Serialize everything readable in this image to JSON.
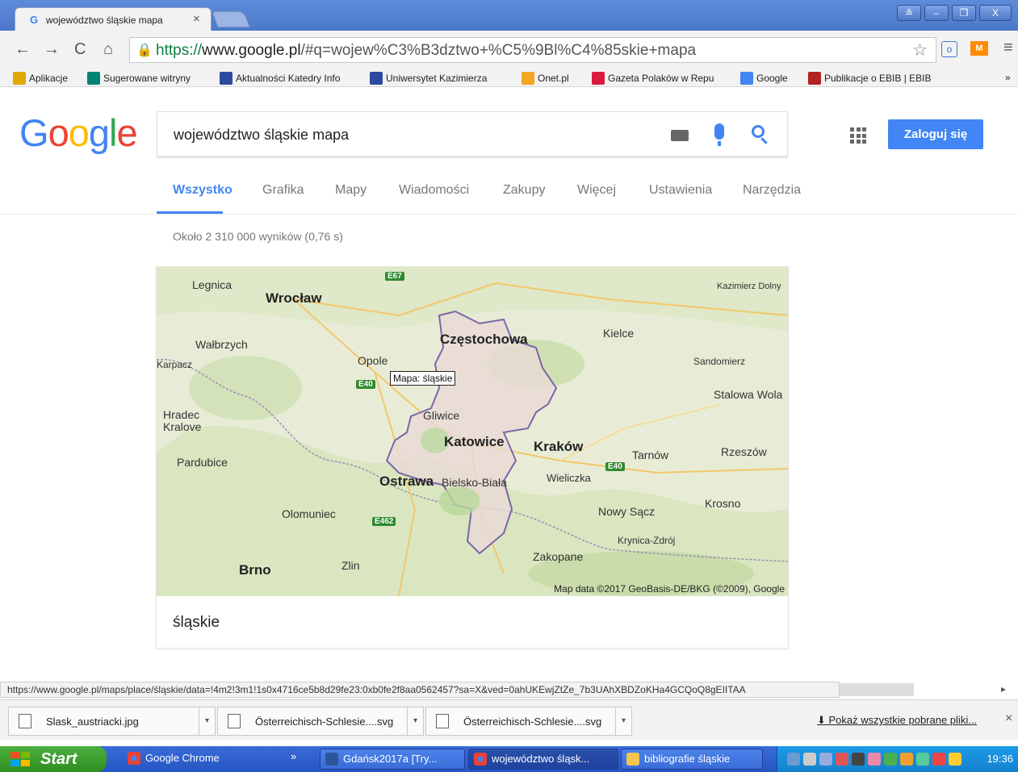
{
  "browser": {
    "tab_title": "województwo śląskie mapa",
    "tab_favicon": "G",
    "tab_close": "×",
    "url_scheme": "https://",
    "url_host": "www.google.pl",
    "url_path": "/#q=wojew%C3%B3dztwo+%C5%9Bl%C4%85skie+mapa",
    "window_buttons": [
      "≗",
      "–",
      "❐",
      "X"
    ],
    "bookmarks": [
      {
        "label": "Aplikacje",
        "icon": "apps-icon",
        "color": "#e0a800"
      },
      {
        "label": "Sugerowane witryny",
        "icon": "bing-icon",
        "color": "#008373"
      },
      {
        "label": "Aktualności Katedry Info",
        "icon": "university-icon",
        "color": "#2b4aa0"
      },
      {
        "label": "Uniwersytet Kazimierza",
        "icon": "university-icon",
        "color": "#2b4aa0"
      },
      {
        "label": "Onet.pl",
        "icon": "onet-icon",
        "color": "#f5a623"
      },
      {
        "label": "Gazeta Polaków w Repu",
        "icon": "gazeta-icon",
        "color": "#d81b3f"
      },
      {
        "label": "Google",
        "icon": "google-icon",
        "color": "#4285f4"
      },
      {
        "label": "Publikacje o EBIB | EBIB",
        "icon": "ebib-icon",
        "color": "#b22222"
      }
    ],
    "more_bookmarks": "»"
  },
  "google": {
    "logo": [
      "G",
      "o",
      "o",
      "g",
      "l",
      "e"
    ],
    "logo_colors": [
      "#4285f4",
      "#ea4335",
      "#fbbc05",
      "#4285f4",
      "#34a853",
      "#ea4335"
    ],
    "query": "województwo śląskie mapa",
    "signin": "Zaloguj się",
    "tabs": [
      "Wszystko",
      "Grafika",
      "Mapy",
      "Wiadomości",
      "Zakupy",
      "Więcej",
      "Ustawienia",
      "Narzędzia"
    ],
    "stats": "Około 2 310 000 wyników (0,76 s)",
    "card_title": "śląskie"
  },
  "map": {
    "tooltip": "Mapa: śląskie",
    "attribution": "Map data ©2017 GeoBasis-DE/BKG (©2009), Google",
    "cities_big": [
      "Wrocław",
      "Częstochowa",
      "Katowice",
      "Kraków",
      "Ostrawa"
    ],
    "cities": [
      "Legnica",
      "Wałbrzych",
      "Karpacz",
      "Opole",
      "Kielce",
      "Sandomierz",
      "Stalowa Wola",
      "Hradec Kralove",
      "Gliwice",
      "Pardubice",
      "Bielsko-Biała",
      "Wieliczka",
      "Tarnów",
      "Rzeszów",
      "Krosno",
      "Nowy Sącz",
      "Olomuniec",
      "Krynica-Zdrój",
      "Zakopane",
      "Brno",
      "Zlin"
    ],
    "cities_small": [
      "Kazimierz Dolny"
    ],
    "routes": [
      "E67",
      "E40",
      "E40",
      "E462"
    ]
  },
  "status": {
    "hover_url": "https://www.google.pl/maps/place/śląskie/data=!4m2!3m1!1s0x4716ce5b8d29fe23:0xb0fe2f8aa0562457?sa=X&ved=0ahUKEwjZtZe_7b3UAhXBDZoKHa4GCQoQ8gEIITAA"
  },
  "downloads": {
    "items": [
      "Slask_austriacki.jpg",
      "Österreichisch-Schlesie....svg",
      "Österreichisch-Schlesie....svg"
    ],
    "show_all": "Pokaż wszystkie pobrane pliki...",
    "close": "×"
  },
  "taskbar": {
    "start": "Start",
    "tasks": [
      "Google Chrome",
      "Gdańsk2017a [Try...",
      "województwo śląsk...",
      "bibliografie śląskie"
    ],
    "more": "»",
    "clock": "19:36"
  }
}
